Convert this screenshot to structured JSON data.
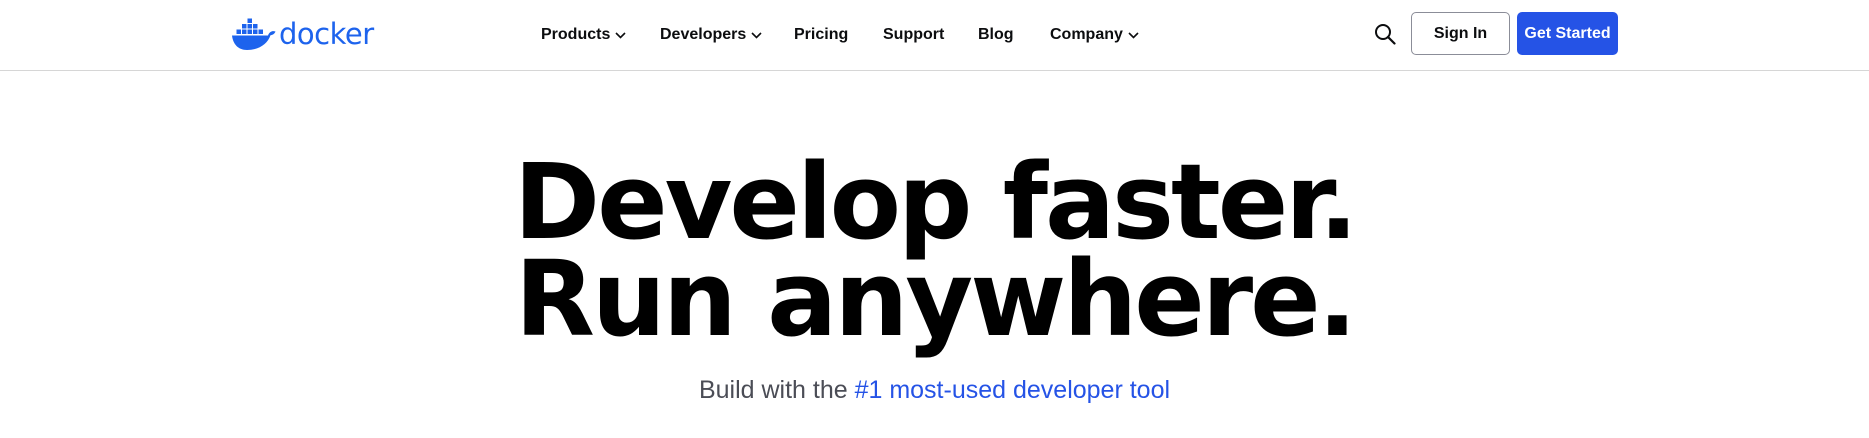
{
  "brand": {
    "name": "docker",
    "logo_icon": "docker-whale-icon",
    "color": "#1d63ed"
  },
  "nav": {
    "items": [
      {
        "label": "Products",
        "has_dropdown": true
      },
      {
        "label": "Developers",
        "has_dropdown": true
      },
      {
        "label": "Pricing",
        "has_dropdown": false
      },
      {
        "label": "Support",
        "has_dropdown": false
      },
      {
        "label": "Blog",
        "has_dropdown": false
      },
      {
        "label": "Company",
        "has_dropdown": true
      }
    ],
    "search_icon": "search-icon",
    "sign_in_label": "Sign In",
    "get_started_label": "Get Started",
    "accent_color": "#2553e6"
  },
  "hero": {
    "line1": "Develop faster.",
    "line2": "Run anywhere.",
    "subtitle_prefix": "Build with the ",
    "subtitle_link": "#1 most-used developer tool"
  }
}
